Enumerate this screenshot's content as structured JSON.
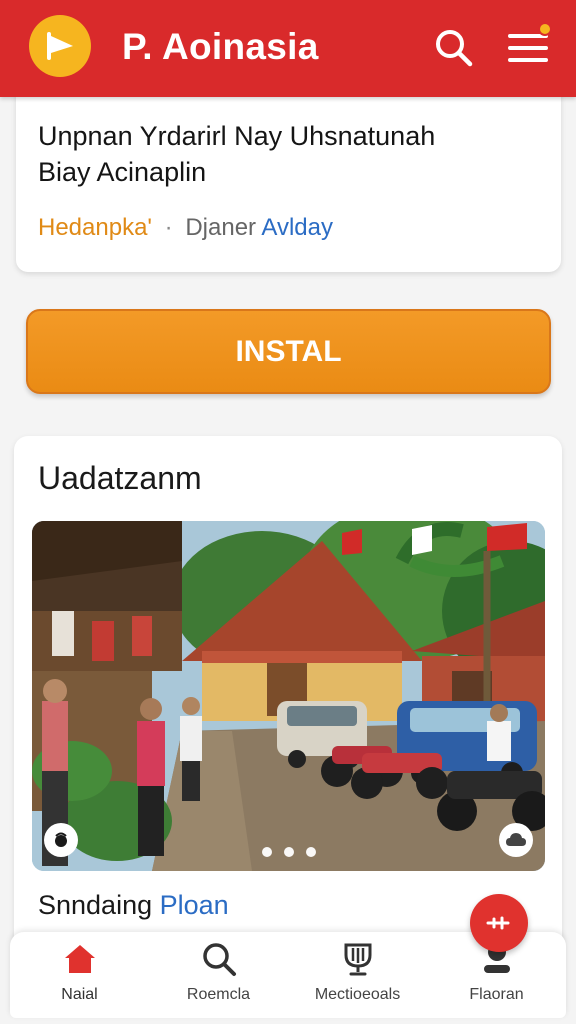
{
  "header": {
    "title": "P. Aoinasia",
    "logo_icon": "play-flag-icon",
    "search_icon": "search-icon",
    "menu_icon": "hamburger-menu-icon",
    "accent": "#d92a2b",
    "logo_color": "#f6b51f"
  },
  "article": {
    "title_line1": "Unpnan Yrdarirl Nay Uhsnatunah",
    "title_line2": "Biay Acinaplin",
    "category": "Hedanpka'",
    "separator": "·",
    "author": "Djaner",
    "date": "Avlday"
  },
  "install": {
    "label": "INSTAL",
    "color": "#f39a27"
  },
  "gallery": {
    "heading": "Uadatzanm",
    "caption_start": "Snndaing",
    "caption_accent": "Ploan",
    "slide_count": 3,
    "active_slide": 1,
    "left_button_icon": "audio-icon",
    "right_button_icon": "cloud-icon"
  },
  "fab": {
    "icon": "arrow-icon",
    "color": "#e0322e"
  },
  "nav": {
    "items": [
      {
        "label": "Naial",
        "icon": "home-icon",
        "active": true
      },
      {
        "label": "Roemcla",
        "icon": "search-icon",
        "active": false
      },
      {
        "label": "Mectioeoals",
        "icon": "trophy-icon",
        "active": false
      },
      {
        "label": "Flaoran",
        "icon": "profile-icon",
        "active": false
      }
    ]
  }
}
